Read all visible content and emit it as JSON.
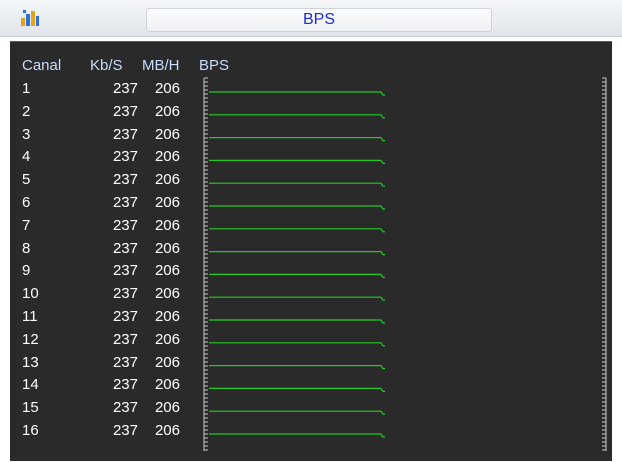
{
  "window": {
    "title": "BPS",
    "icon": "network-chart-icon"
  },
  "table": {
    "columns": {
      "channel": "Canal",
      "kbs": "Kb/S",
      "mbh": "MB/H",
      "bps": "BPS"
    },
    "rows": [
      {
        "channel": "1",
        "kbs": "237",
        "mbh": "206"
      },
      {
        "channel": "2",
        "kbs": "237",
        "mbh": "206"
      },
      {
        "channel": "3",
        "kbs": "237",
        "mbh": "206"
      },
      {
        "channel": "4",
        "kbs": "237",
        "mbh": "206"
      },
      {
        "channel": "5",
        "kbs": "237",
        "mbh": "206"
      },
      {
        "channel": "6",
        "kbs": "237",
        "mbh": "206"
      },
      {
        "channel": "7",
        "kbs": "237",
        "mbh": "206"
      },
      {
        "channel": "8",
        "kbs": "237",
        "mbh": "206"
      },
      {
        "channel": "9",
        "kbs": "237",
        "mbh": "206"
      },
      {
        "channel": "10",
        "kbs": "237",
        "mbh": "206"
      },
      {
        "channel": "11",
        "kbs": "237",
        "mbh": "206"
      },
      {
        "channel": "12",
        "kbs": "237",
        "mbh": "206"
      },
      {
        "channel": "13",
        "kbs": "237",
        "mbh": "206"
      },
      {
        "channel": "14",
        "kbs": "237",
        "mbh": "206"
      },
      {
        "channel": "15",
        "kbs": "237",
        "mbh": "206"
      },
      {
        "channel": "16",
        "kbs": "237",
        "mbh": "206"
      }
    ]
  },
  "colors": {
    "title_text": "#1a2bd8",
    "panel_bg": "#2a2a2a",
    "header_text": "#c9dcff",
    "trace": "#22cc22",
    "scale": "#c8c8c8"
  }
}
